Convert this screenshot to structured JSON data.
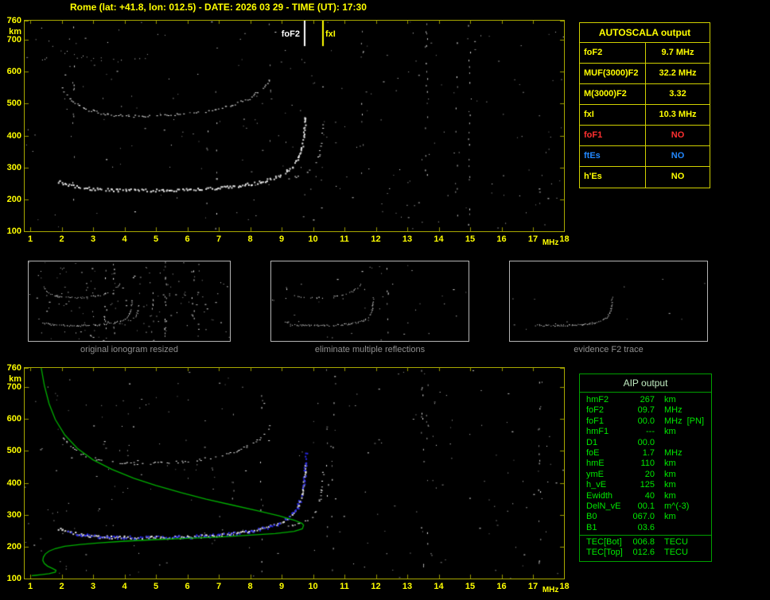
{
  "header": {
    "title": "Rome (lat: +41.8, lon: 012.5) - DATE: 2026 03 29 - TIME (UT): 17:30"
  },
  "autoscala_table": {
    "title": "AUTOSCALA output",
    "rows": [
      {
        "label": "foF2",
        "value": "9.7 MHz",
        "color": "#ffff00"
      },
      {
        "label": "MUF(3000)F2",
        "value": "32.2 MHz",
        "color": "#ffff00"
      },
      {
        "label": "M(3000)F2",
        "value": "3.32",
        "color": "#ffff00"
      },
      {
        "label": "fxI",
        "value": "10.3 MHz",
        "color": "#ffff00"
      },
      {
        "label": "foF1",
        "value": "NO",
        "color": "#ff3030"
      },
      {
        "label": "ftEs",
        "value": "NO",
        "color": "#2288ff"
      },
      {
        "label": "h'Es",
        "value": "NO",
        "color": "#ffff00"
      }
    ]
  },
  "panels": [
    {
      "caption": "original ionogram resized"
    },
    {
      "caption": "eliminate multiple reflections"
    },
    {
      "caption": "evidence F2 trace"
    }
  ],
  "aip_table": {
    "title": "AIP output",
    "rows": [
      {
        "label": "hmF2",
        "value": "267",
        "unit": "km",
        "note": ""
      },
      {
        "label": "foF2",
        "value": "09.7",
        "unit": "MHz",
        "note": ""
      },
      {
        "label": "foF1",
        "value": "00.0",
        "unit": "MHz",
        "note": "[PN]"
      },
      {
        "label": "hmF1",
        "value": "---",
        "unit": "km",
        "note": ""
      },
      {
        "label": "D1",
        "value": "00.0",
        "unit": "",
        "note": ""
      },
      {
        "label": "foE",
        "value": "1.7",
        "unit": "MHz",
        "note": ""
      },
      {
        "label": "hmE",
        "value": "110",
        "unit": "km",
        "note": ""
      },
      {
        "label": "ymE",
        "value": "20",
        "unit": "km",
        "note": ""
      },
      {
        "label": "h_vE",
        "value": "125",
        "unit": "km",
        "note": ""
      },
      {
        "label": "Ewidth",
        "value": "40",
        "unit": "km",
        "note": ""
      },
      {
        "label": "DelN_vE",
        "value": "00.1",
        "unit": "m^(-3)",
        "note": ""
      },
      {
        "label": "B0",
        "value": "067.0",
        "unit": "km",
        "note": ""
      },
      {
        "label": "B1",
        "value": "03.6",
        "unit": "",
        "note": ""
      }
    ],
    "tec_rows": [
      {
        "label": "TEC[Bot]",
        "value": "006.8",
        "unit": "TECU"
      },
      {
        "label": "TEC[Top]",
        "value": "012.6",
        "unit": "TECU"
      }
    ]
  },
  "chart_data": [
    {
      "id": "top-ionogram",
      "type": "scatter",
      "xlabel": "MHz",
      "ylabel": "km",
      "xlim": [
        1,
        18
      ],
      "ylim": [
        100,
        760
      ],
      "xticks": [
        1,
        2,
        3,
        4,
        5,
        6,
        7,
        8,
        9,
        10,
        11,
        12,
        13,
        14,
        15,
        16,
        17,
        18
      ],
      "yticks": [
        760,
        700,
        600,
        500,
        400,
        300,
        200,
        100
      ],
      "markers": [
        {
          "label": "foF2",
          "x": 9.7,
          "color": "#ffffff"
        },
        {
          "label": "fxI",
          "x": 10.3,
          "color": "#ffff00"
        }
      ],
      "traces": {
        "f2_first_hop": [
          [
            1.9,
            258
          ],
          [
            2.2,
            246
          ],
          [
            2.6,
            239
          ],
          [
            3.0,
            234
          ],
          [
            3.6,
            231
          ],
          [
            4.4,
            230
          ],
          [
            5.2,
            230
          ],
          [
            6.0,
            232
          ],
          [
            6.8,
            236
          ],
          [
            7.5,
            243
          ],
          [
            8.1,
            252
          ],
          [
            8.6,
            264
          ],
          [
            9.0,
            279
          ],
          [
            9.3,
            299
          ],
          [
            9.5,
            326
          ],
          [
            9.62,
            357
          ],
          [
            9.69,
            396
          ],
          [
            9.73,
            436
          ],
          [
            9.75,
            468
          ]
        ],
        "f2_second_hop": [
          [
            2.0,
            548
          ],
          [
            2.3,
            510
          ],
          [
            2.7,
            486
          ],
          [
            3.2,
            471
          ],
          [
            3.8,
            463
          ],
          [
            4.6,
            461
          ],
          [
            5.4,
            464
          ],
          [
            6.2,
            471
          ],
          [
            6.9,
            482
          ],
          [
            7.5,
            498
          ],
          [
            8.0,
            519
          ],
          [
            8.4,
            549
          ],
          [
            8.65,
            586
          ]
        ],
        "f2_x_mode": [
          [
            9.2,
            263
          ],
          [
            9.7,
            279
          ],
          [
            10.0,
            299
          ],
          [
            10.15,
            327
          ],
          [
            10.24,
            363
          ],
          [
            10.29,
            407
          ],
          [
            10.31,
            452
          ]
        ],
        "upper_multiples": [
          [
            1.5,
            700
          ],
          [
            1.9,
            672
          ],
          [
            2.4,
            653
          ],
          [
            3.0,
            641
          ],
          [
            3.7,
            637
          ],
          [
            4.3,
            641
          ],
          [
            4.9,
            651
          ]
        ]
      }
    },
    {
      "id": "bottom-ionogram",
      "type": "scatter",
      "xlabel": "MHz",
      "ylabel": "km",
      "xlim": [
        1,
        18
      ],
      "ylim": [
        100,
        760
      ],
      "xticks": [
        1,
        2,
        3,
        4,
        5,
        6,
        7,
        8,
        9,
        10,
        11,
        12,
        13,
        14,
        15,
        16,
        17,
        18
      ],
      "yticks": [
        760,
        700,
        600,
        500,
        400,
        300,
        200,
        100
      ],
      "traces_from": "top-ionogram",
      "overlays": {
        "trace_color": "#2a2aee",
        "profile_color": "#00b000",
        "profile": [
          [
            1.35,
            760
          ],
          [
            1.45,
            705
          ],
          [
            1.6,
            648
          ],
          [
            1.8,
            598
          ],
          [
            2.1,
            550
          ],
          [
            2.5,
            508
          ],
          [
            3.0,
            472
          ],
          [
            3.6,
            442
          ],
          [
            4.3,
            414
          ],
          [
            5.0,
            392
          ],
          [
            5.8,
            369
          ],
          [
            6.6,
            349
          ],
          [
            7.4,
            331
          ],
          [
            8.2,
            313
          ],
          [
            8.9,
            297
          ],
          [
            9.4,
            283
          ],
          [
            9.65,
            273
          ],
          [
            9.7,
            267
          ],
          [
            9.66,
            256
          ],
          [
            9.4,
            248
          ],
          [
            8.8,
            241
          ],
          [
            8.0,
            236
          ],
          [
            7.0,
            230
          ],
          [
            6.0,
            226
          ],
          [
            5.0,
            222
          ],
          [
            4.0,
            217
          ],
          [
            3.2,
            212
          ],
          [
            2.6,
            207
          ],
          [
            2.1,
            201
          ],
          [
            1.8,
            194
          ],
          [
            1.6,
            186
          ],
          [
            1.48,
            177
          ],
          [
            1.42,
            167
          ],
          [
            1.4,
            157
          ],
          [
            1.45,
            147
          ],
          [
            1.55,
            139
          ],
          [
            1.7,
            132
          ],
          [
            1.82,
            126
          ],
          [
            1.8,
            120
          ],
          [
            1.6,
            115
          ],
          [
            1.35,
            112
          ],
          [
            1.15,
            110
          ],
          [
            1.05,
            109
          ]
        ]
      }
    }
  ]
}
